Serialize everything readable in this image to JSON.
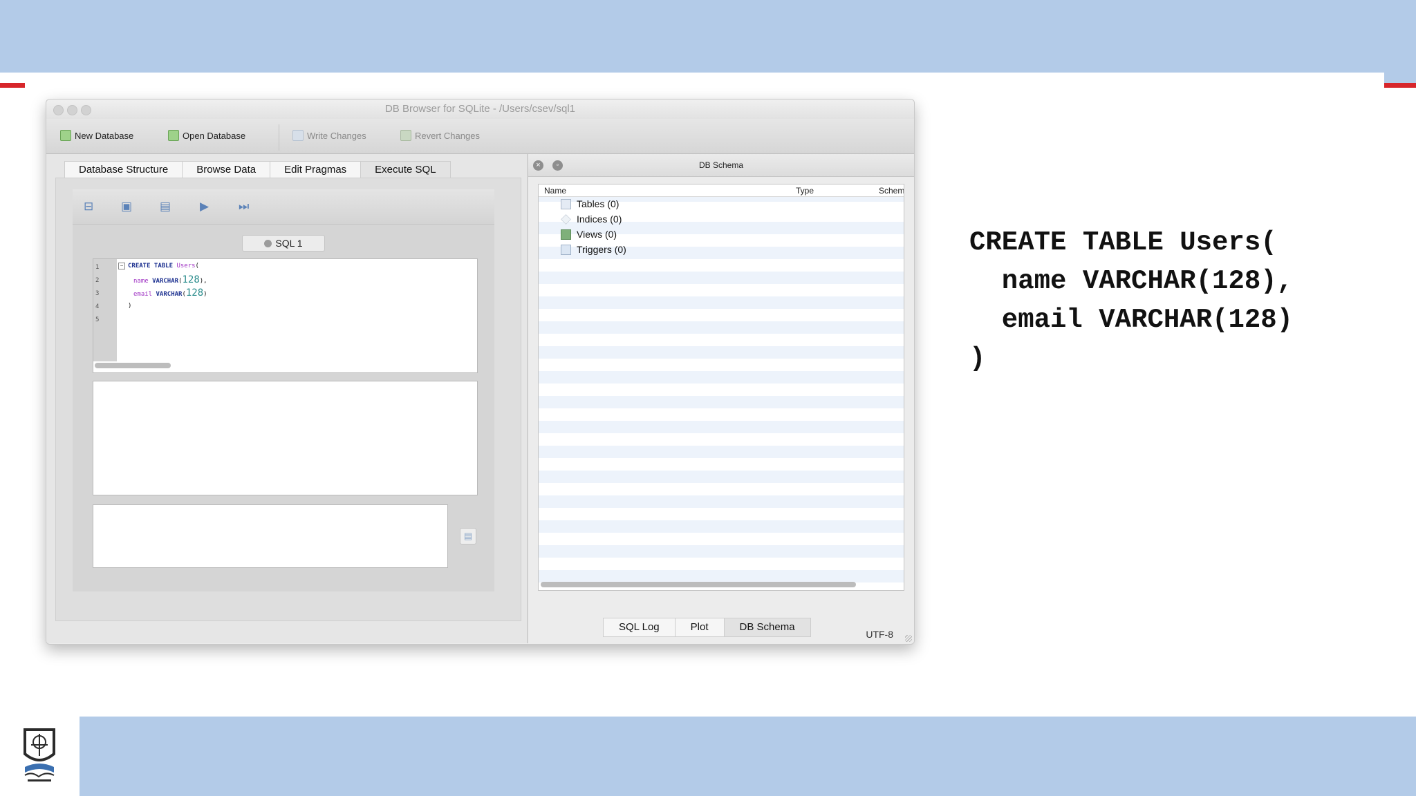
{
  "window": {
    "title": "DB Browser for SQLite - /Users/csev/sql1"
  },
  "toolbar": {
    "new_database": "New Database",
    "open_database": "Open Database",
    "write_changes": "Write Changes",
    "revert_changes": "Revert Changes"
  },
  "tabs": [
    "Database Structure",
    "Browse Data",
    "Edit Pragmas",
    "Execute SQL"
  ],
  "sql_tab": "SQL 1",
  "editor": {
    "line_numbers": [
      "1",
      "2",
      "3",
      "4",
      "5"
    ],
    "line1": {
      "kw1": "CREATE TABLE",
      "id": "Users",
      "p": "("
    },
    "line2": {
      "id": "name",
      "kw": "VARCHAR",
      "p1": "(",
      "num": "128",
      "p2": "),"
    },
    "line3": {
      "id": "email",
      "kw": "VARCHAR",
      "p1": "(",
      "num": "128",
      "p2": ")"
    },
    "line4": {
      "p": ")"
    }
  },
  "schema": {
    "title": "DB Schema",
    "columns": [
      "Name",
      "Type",
      "Schem"
    ],
    "rows": [
      "Tables (0)",
      "Indices (0)",
      "Views (0)",
      "Triggers (0)"
    ]
  },
  "bottom_tabs": [
    "SQL Log",
    "Plot",
    "DB Schema"
  ],
  "status_encoding": "UTF-8",
  "slide_code": "CREATE TABLE Users(\n  name VARCHAR(128),\n  email VARCHAR(128)\n)",
  "colors": {
    "band": "#b3cbe8",
    "accent_red": "#d7262b"
  }
}
